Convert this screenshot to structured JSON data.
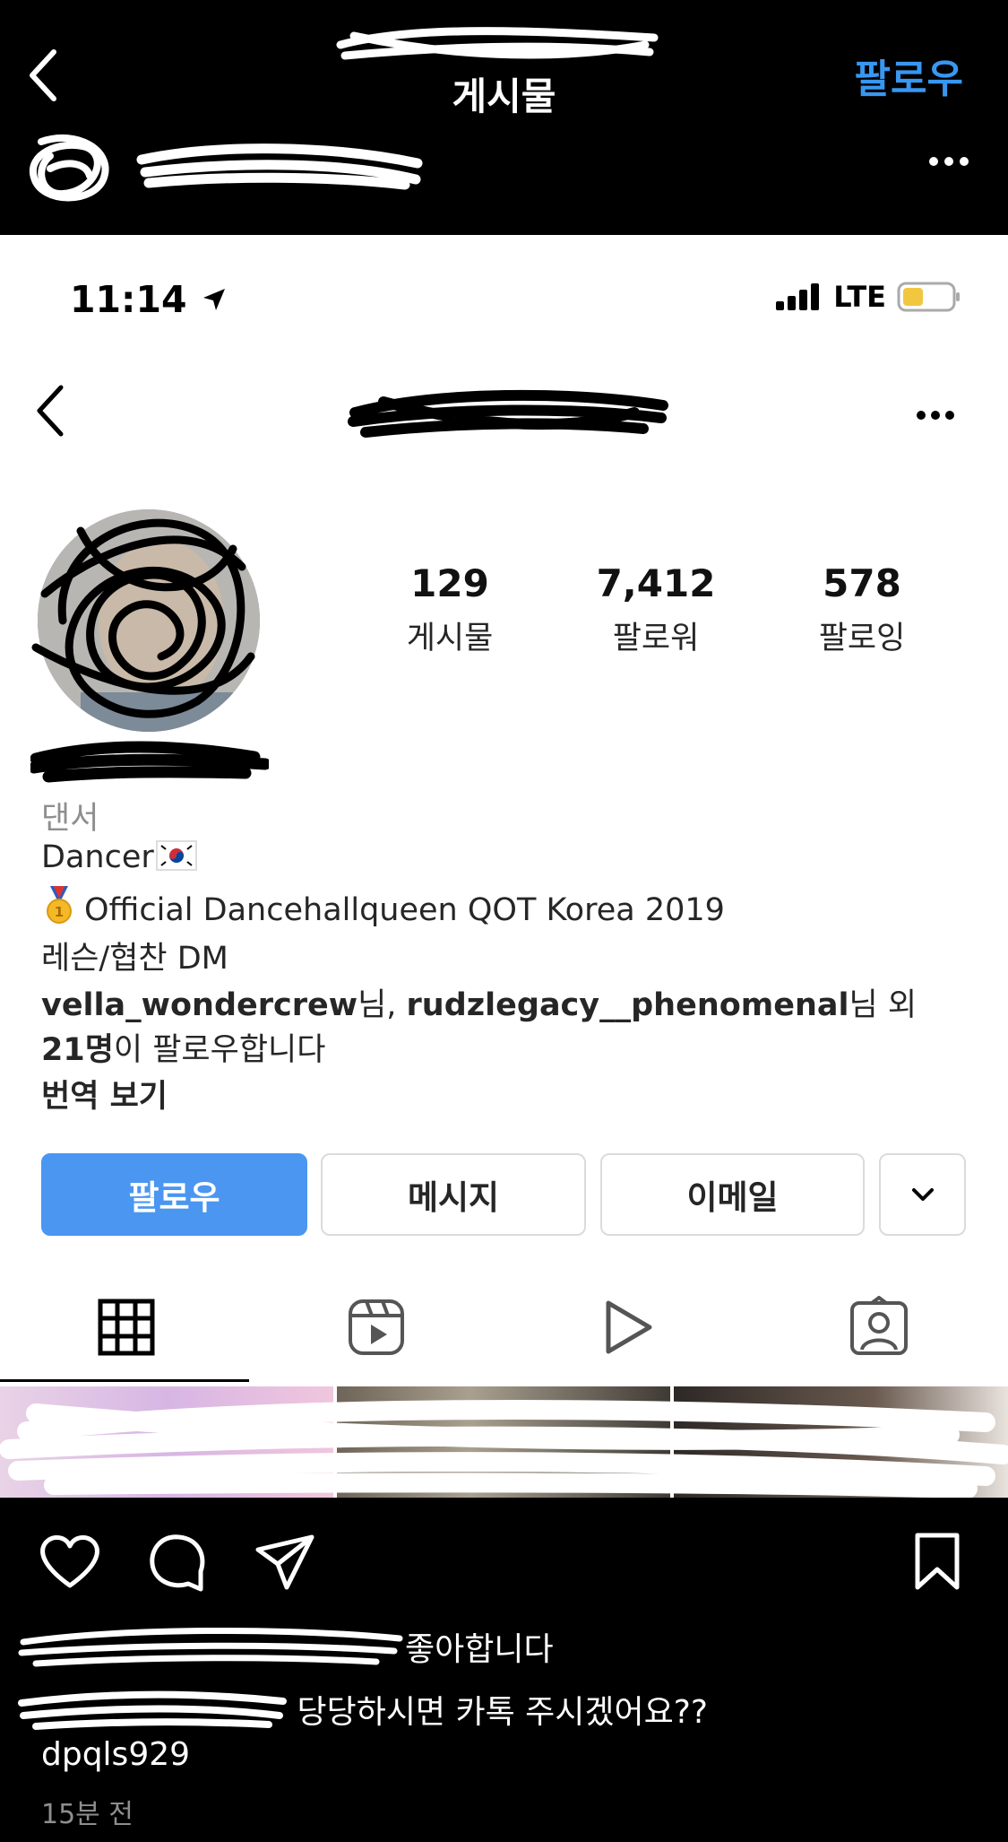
{
  "outer": {
    "title": "게시물",
    "follow_label": "팔로우",
    "back_icon": "chevron-left-icon",
    "more_icon": "ellipsis-icon"
  },
  "status_bar": {
    "time": "11:14",
    "network": "LTE"
  },
  "profile": {
    "stats": [
      {
        "value": "129",
        "label": "게시물"
      },
      {
        "value": "7,412",
        "label": "팔로워"
      },
      {
        "value": "578",
        "label": "팔로잉"
      }
    ],
    "category": "댄서",
    "bio": {
      "line1": "Dancer",
      "line2": "Official Dancehallqueen QOT Korea 2019",
      "line3": "레슨/협찬 DM"
    },
    "followed_by": {
      "user1": "vella_wondercrew",
      "sep1": "님, ",
      "user2": "rudzlegacy__phenomenal",
      "sep2": "님 외",
      "count": "21명",
      "suffix": "이 팔로우합니다"
    },
    "see_translation": "번역 보기",
    "buttons": {
      "follow": "팔로우",
      "message": "메시지",
      "email": "이메일"
    }
  },
  "post": {
    "likes_text": "좋아합니다",
    "caption": "당당하시면 카톡 주시겠어요??",
    "caption_line2": "dpqls929",
    "timestamp": "15분 전"
  },
  "colors": {
    "accent": "#3897f0",
    "follow_button": "#4a96f1",
    "background": "#000000"
  }
}
